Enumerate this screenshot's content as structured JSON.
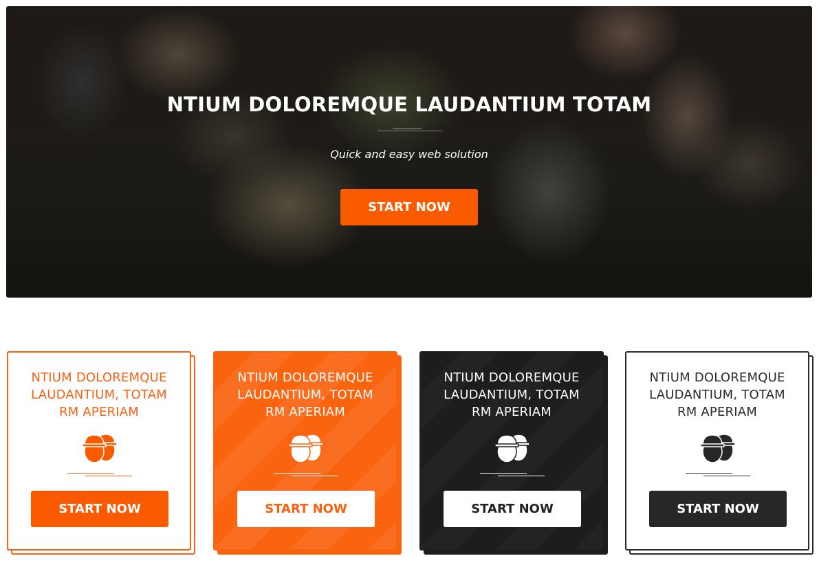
{
  "hero": {
    "title": "NTIUM DOLOREMQUE LAUDANTIUM TOTAM",
    "subtitle": "Quick and easy web solution",
    "button_label": "START NOW"
  },
  "cards": [
    {
      "title": "NTIUM DOLOREMQUE LAUDANTIUM, TOTAM RM APERIAM",
      "icon": "construction-workers-icon",
      "button_label": "START NOW",
      "style": "white-orange",
      "accent": "#f86112"
    },
    {
      "title": "NTIUM DOLOREMQUE LAUDANTIUM, TOTAM RM APERIAM",
      "icon": "construction-workers-icon",
      "button_label": "START NOW",
      "style": "orange",
      "accent": "#fa640f"
    },
    {
      "title": "NTIUM DOLOREMQUE LAUDANTIUM, TOTAM RM APERIAM",
      "icon": "construction-workers-icon",
      "button_label": "START NOW",
      "style": "dark",
      "accent": "#1d1d1d"
    },
    {
      "title": "NTIUM DOLOREMQUE LAUDANTIUM, TOTAM RM APERIAM",
      "icon": "construction-workers-icon",
      "button_label": "START NOW",
      "style": "white-dark",
      "accent": "#272727"
    }
  ],
  "colors": {
    "primary_orange": "#fa5a00",
    "dark": "#1d1d1d",
    "white": "#ffffff"
  }
}
